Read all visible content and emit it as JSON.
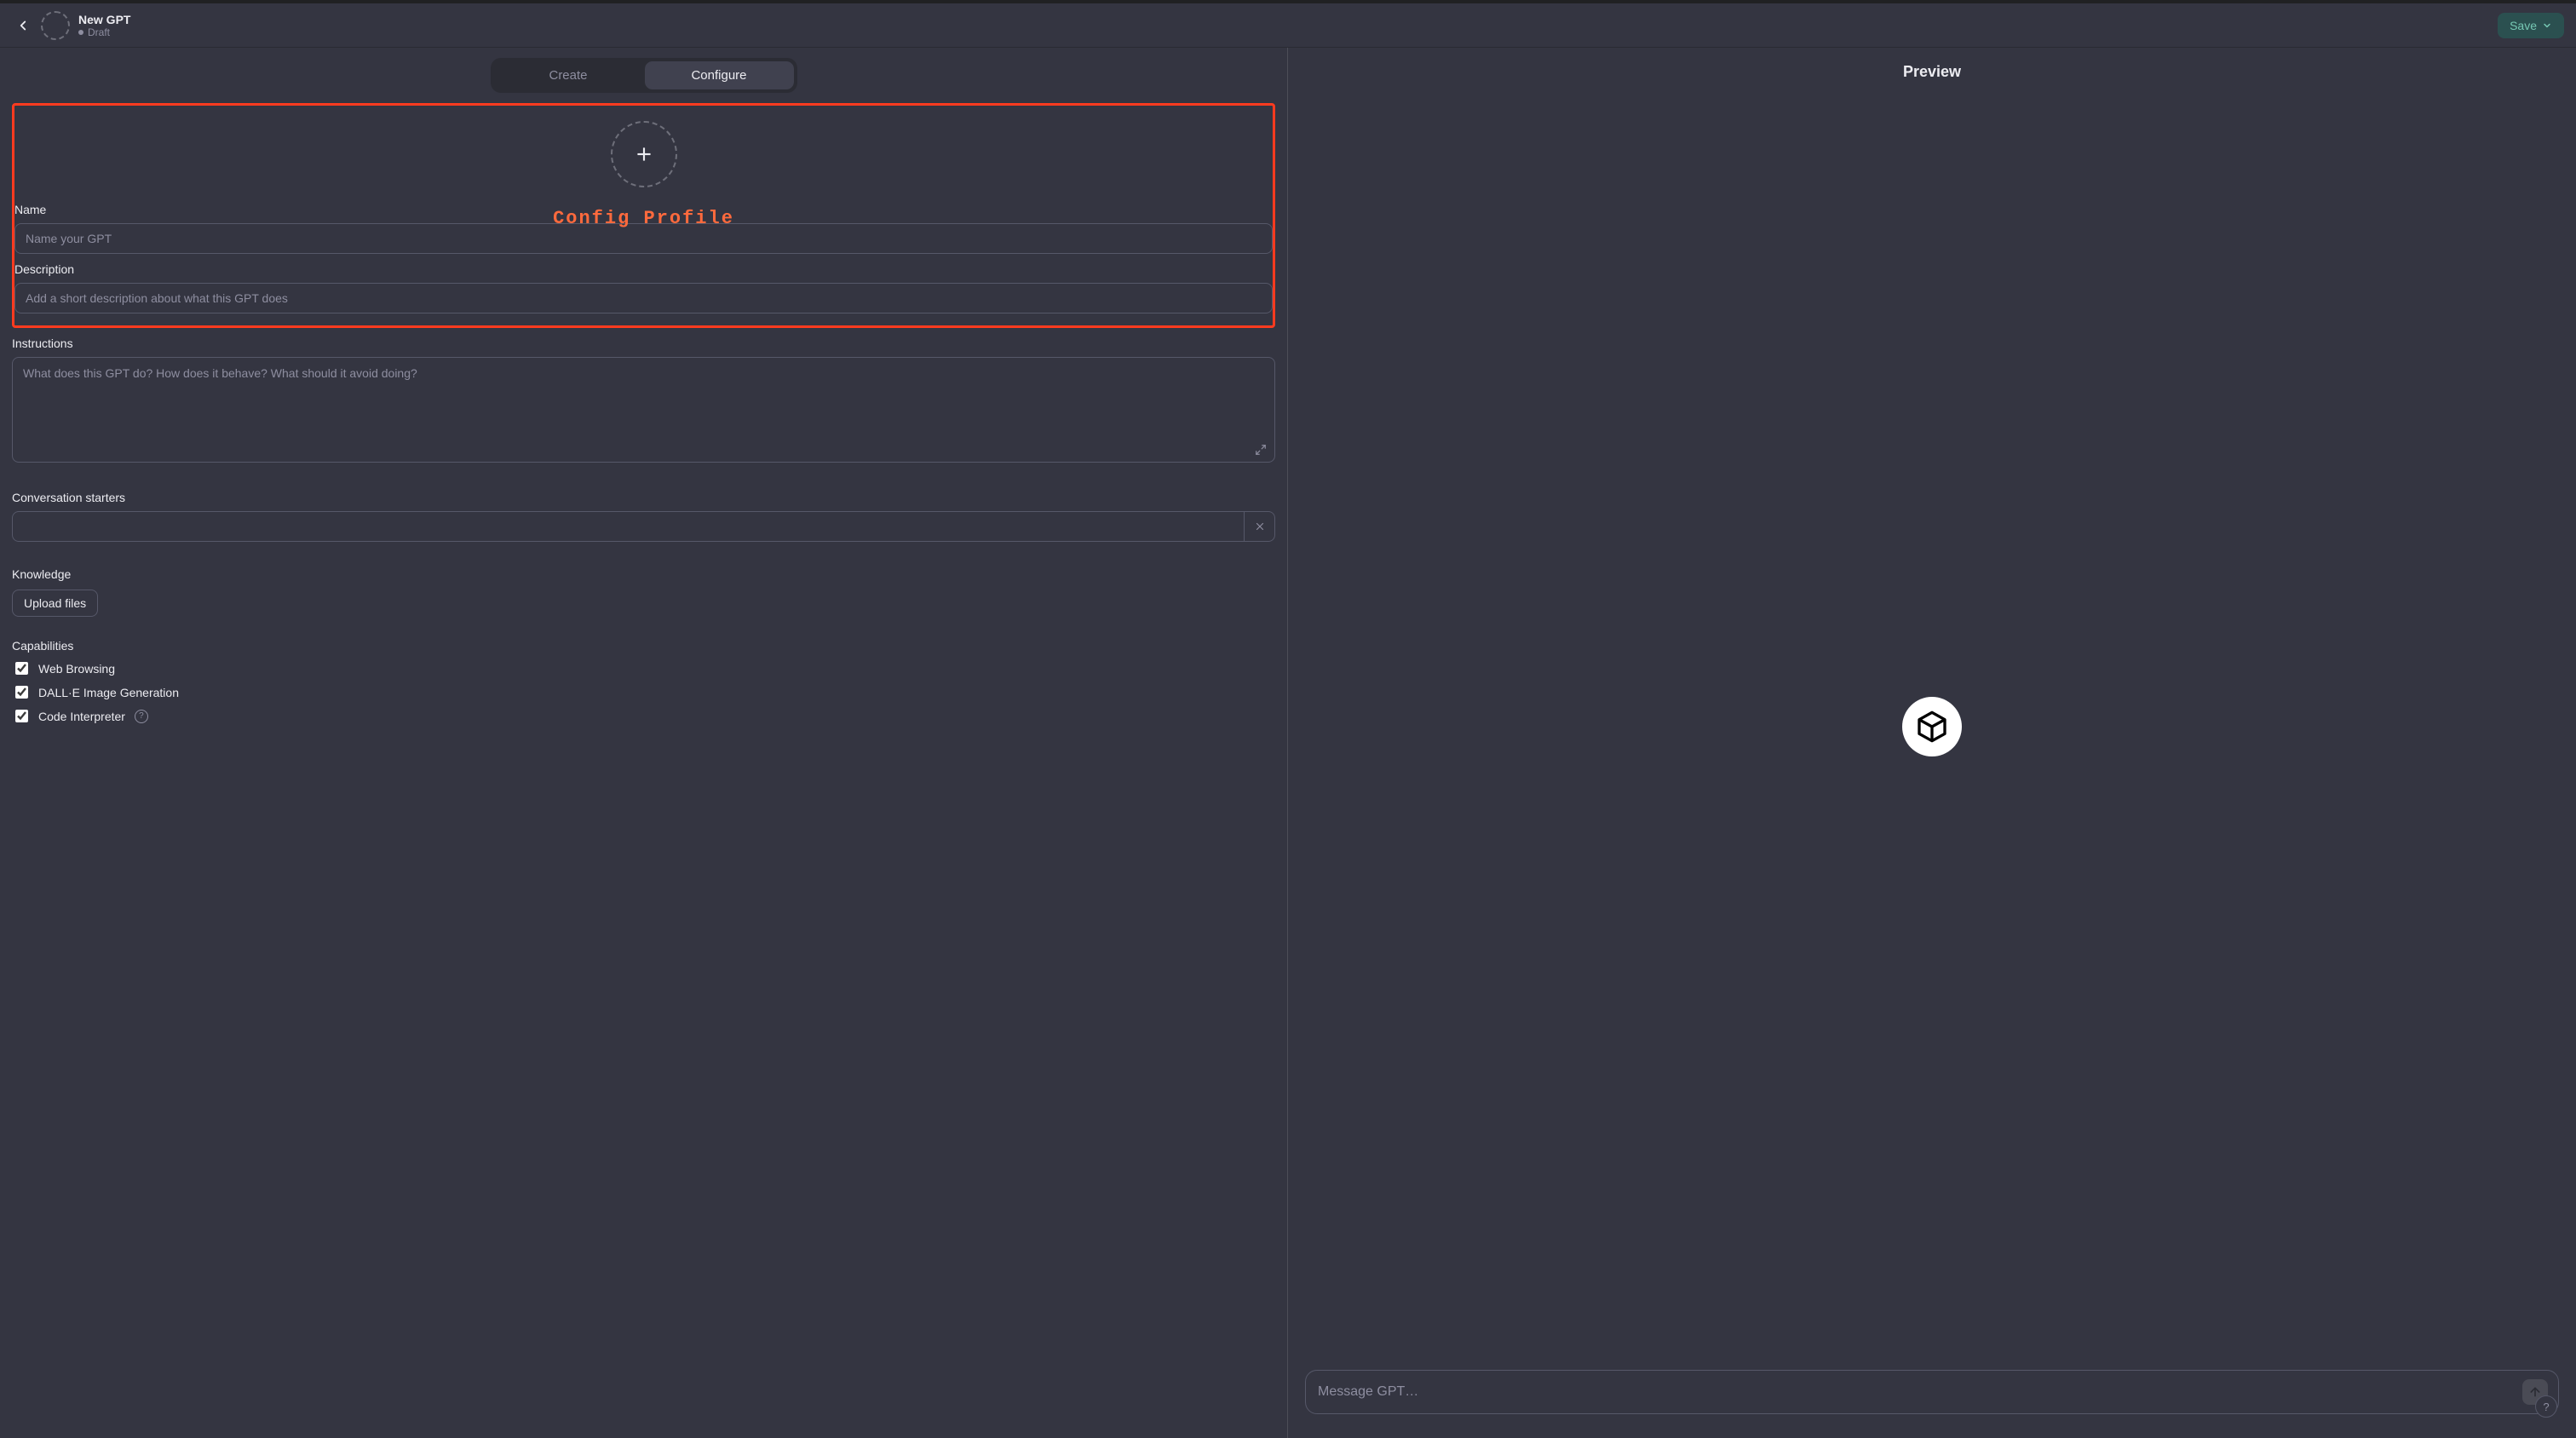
{
  "header": {
    "title": "New GPT",
    "status": "Draft",
    "save_label": "Save"
  },
  "tabs": {
    "create": "Create",
    "configure": "Configure"
  },
  "annotation": {
    "label": "Config Profile"
  },
  "form": {
    "name_label": "Name",
    "name_placeholder": "Name your GPT",
    "description_label": "Description",
    "description_placeholder": "Add a short description about what this GPT does",
    "instructions_label": "Instructions",
    "instructions_placeholder": "What does this GPT do? How does it behave? What should it avoid doing?",
    "starters_label": "Conversation starters",
    "knowledge_label": "Knowledge",
    "upload_label": "Upload files",
    "capabilities_label": "Capabilities",
    "capabilities": [
      {
        "label": "Web Browsing",
        "checked": true
      },
      {
        "label": "DALL·E Image Generation",
        "checked": true
      },
      {
        "label": "Code Interpreter",
        "checked": true
      }
    ]
  },
  "preview": {
    "title": "Preview",
    "input_placeholder": "Message GPT…"
  },
  "misc": {
    "help": "?"
  }
}
